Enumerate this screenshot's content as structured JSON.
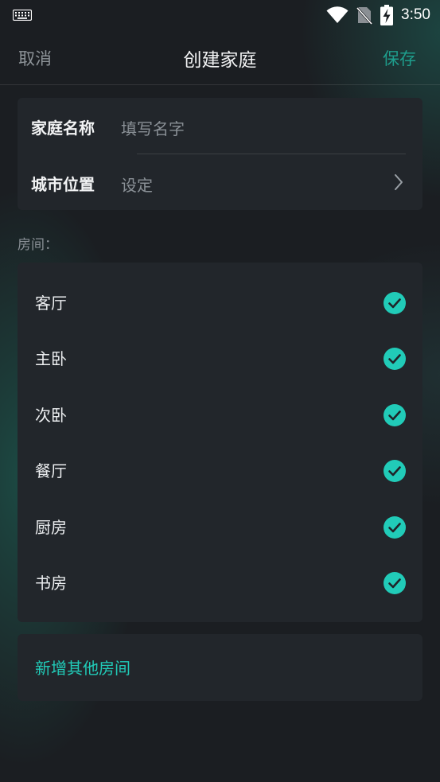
{
  "status_bar": {
    "left_icon": "keyboard-icon",
    "icons": [
      "wifi-icon",
      "no-sim-icon",
      "battery-charging-icon"
    ],
    "time": "3:50"
  },
  "nav": {
    "cancel_label": "取消",
    "title": "创建家庭",
    "save_label": "保存"
  },
  "info": {
    "name_label": "家庭名称",
    "name_placeholder": "填写名字",
    "city_label": "城市位置",
    "city_value": "设定",
    "city_icon": "chevron-right-icon"
  },
  "rooms": {
    "title": "房间：",
    "items": [
      {
        "label": "客厅",
        "checked": true
      },
      {
        "label": "主卧",
        "checked": true
      },
      {
        "label": "次卧",
        "checked": true
      },
      {
        "label": "餐厅",
        "checked": true
      },
      {
        "label": "厨房",
        "checked": true
      },
      {
        "label": "书房",
        "checked": true
      }
    ]
  },
  "add_room": {
    "label": "新增其他房间"
  },
  "colors": {
    "accent": "#21cbb8",
    "save": "#1e9d8c",
    "background": "#1b1e22",
    "card": "#22262b"
  }
}
